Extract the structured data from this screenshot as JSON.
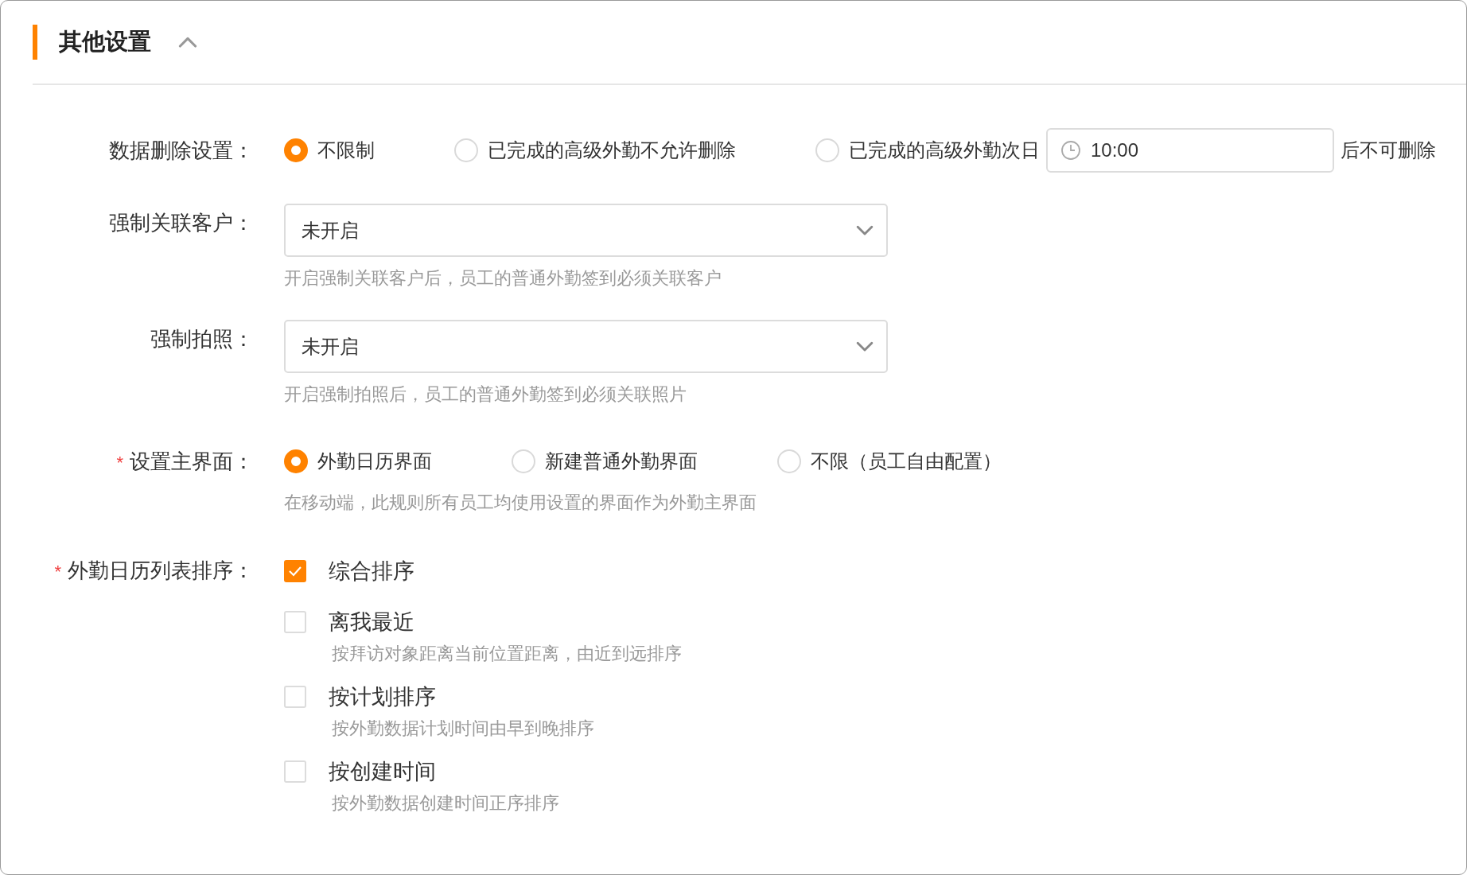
{
  "section": {
    "title": "其他设置",
    "expanded": true
  },
  "fields": [
    {
      "kind": "radio",
      "label": "数据删除设置：",
      "options": [
        {
          "label": "不限制",
          "selected": true
        },
        {
          "label": "已完成的高级外勤不允许删除",
          "selected": false
        },
        {
          "label": "已完成的高级外勤次日",
          "selected": false,
          "time": "10:00",
          "suffix": "后不可删除"
        }
      ]
    },
    {
      "kind": "select",
      "label": "强制关联客户：",
      "value": "未开启",
      "help": "开启强制关联客户后，员工的普通外勤签到必须关联客户"
    },
    {
      "kind": "select",
      "label": "强制拍照：",
      "value": "未开启",
      "help": "开启强制拍照后，员工的普通外勤签到必须关联照片"
    },
    {
      "kind": "radio",
      "label": "设置主界面：",
      "required_mark": "*",
      "options": [
        {
          "label": "外勤日历界面",
          "selected": true
        },
        {
          "label": "新建普通外勤界面",
          "selected": false
        },
        {
          "label": "不限（员工自由配置）",
          "selected": false
        }
      ],
      "help": "在移动端，此规则所有员工均使用设置的界面作为外勤主界面"
    },
    {
      "kind": "checkbox",
      "label": "外勤日历列表排序：",
      "required_mark": "*",
      "options": [
        {
          "label": "综合排序",
          "checked": true
        },
        {
          "label": "离我最近",
          "checked": false,
          "description": "按拜访对象距离当前位置距离，由近到远排序"
        },
        {
          "label": "按计划排序",
          "checked": false,
          "description": "按外勤数据计划时间由早到晚排序"
        },
        {
          "label": "按创建时间",
          "checked": false,
          "description": "按外勤数据创建时间正序排序"
        }
      ]
    }
  ]
}
